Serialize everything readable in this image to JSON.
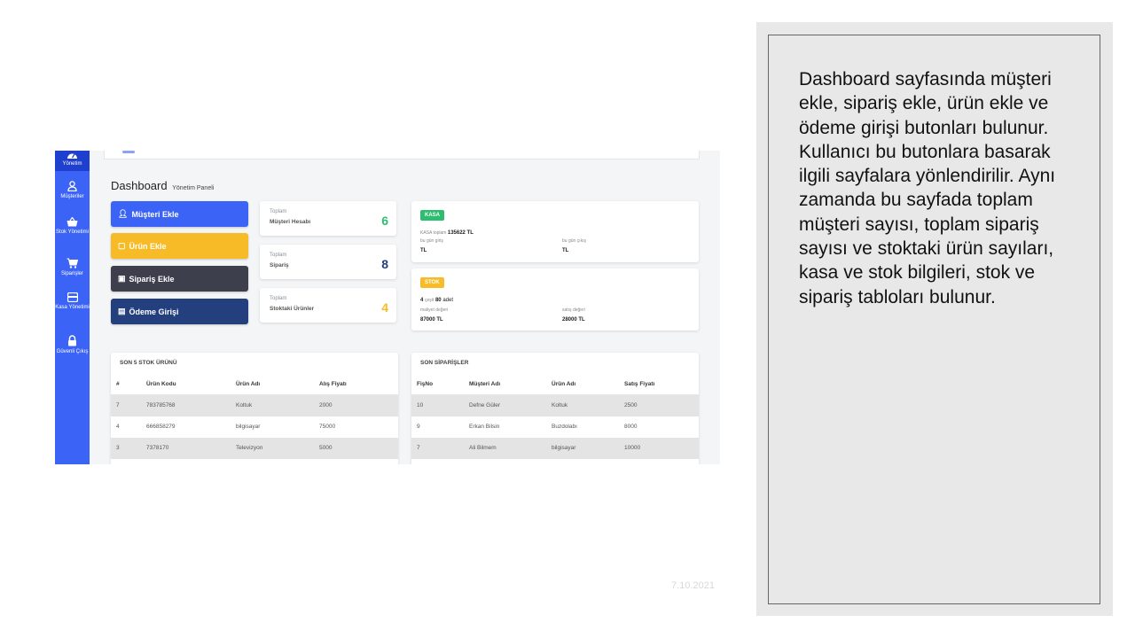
{
  "sidebar": {
    "items": [
      {
        "label": "Yönetim",
        "icon": "dashboard-icon"
      },
      {
        "label": "Müşteriler",
        "icon": "user-icon"
      },
      {
        "label": "Stok Yönetimi",
        "icon": "basket-icon"
      },
      {
        "label": "Siparişler",
        "icon": "cart-icon"
      },
      {
        "label": "Kasa Yönetimi",
        "icon": "wallet-icon"
      },
      {
        "label": "Güvenli Çıkış",
        "icon": "lock-icon"
      }
    ]
  },
  "header": {
    "title": "Dashboard",
    "subtitle": "Yönetim Paneli"
  },
  "actions": [
    {
      "label": "Müşteri Ekle",
      "icon": "user-plus-icon",
      "color": "#3b63f6"
    },
    {
      "label": "Ürün Ekle",
      "icon": "basket-icon",
      "color": "#f6bb26"
    },
    {
      "label": "Sipariş Ekle",
      "icon": "cart-icon",
      "color": "#3d3f4c"
    },
    {
      "label": "Ödeme Girişi",
      "icon": "wallet-icon",
      "color": "#243f7d"
    }
  ],
  "stats": [
    {
      "label1": "Toplam",
      "label2": "Müşteri Hesabı",
      "value": "6",
      "color": "#2dbd6e"
    },
    {
      "label1": "Toplam",
      "label2": "Sipariş",
      "value": "8",
      "color": "#243f7d"
    },
    {
      "label1": "Toplam",
      "label2": "Stoktaki Ürünler",
      "value": "4",
      "color": "#f6bb26"
    }
  ],
  "kasa": {
    "badge": "KASA",
    "total_prefix": "KASA toplam",
    "total": "135622 TL",
    "in_label": "bu gün giriş",
    "in_value": "TL",
    "out_label": "bu gün çıkış",
    "out_value": "TL"
  },
  "stok": {
    "badge": "STOK",
    "count": "4",
    "count_mid": "çeşit",
    "qty": "80",
    "qty_unit": "adet",
    "cost_label": "maliyet değeri",
    "cost_value": "87000 TL",
    "sale_label": "satış değeri",
    "sale_value": "28000 TL"
  },
  "stock_table": {
    "title": "SON 5 STOK ÜRÜNÜ",
    "headers": [
      "#",
      "Ürün Kodu",
      "Ürün Adı",
      "Alış Fiyatı"
    ],
    "rows": [
      [
        "7",
        "783785768",
        "Koltuk",
        "2000"
      ],
      [
        "4",
        "666858279",
        "bilgisayar",
        "75000"
      ],
      [
        "3",
        "7378170",
        "Televizyon",
        "5000"
      ]
    ]
  },
  "order_table": {
    "title": "SON SİPARİŞLER",
    "headers": [
      "FişNo",
      "Müşteri Adı",
      "Ürün Adı",
      "Satış Fiyatı"
    ],
    "rows": [
      [
        "10",
        "Defne Güler",
        "Koltuk",
        "2500"
      ],
      [
        "9",
        "Erkan Bilsin",
        "Buzdolabı",
        "8000"
      ],
      [
        "7",
        "Ali Bilmem",
        "bilgisayar",
        "10000"
      ]
    ]
  },
  "note": "Dashboard sayfasında müşteri ekle, sipariş ekle, ürün ekle ve ödeme girişi butonları bulunur. Kullanıcı bu butonlara basarak ilgili sayfalara yönlendirilir. Aynı zamanda bu sayfada toplam müşteri sayısı, toplam sipariş sayısı ve stoktaki ürün sayıları, kasa ve stok bilgileri, stok ve sipariş tabloları bulunur.",
  "date": "7.10.2021"
}
